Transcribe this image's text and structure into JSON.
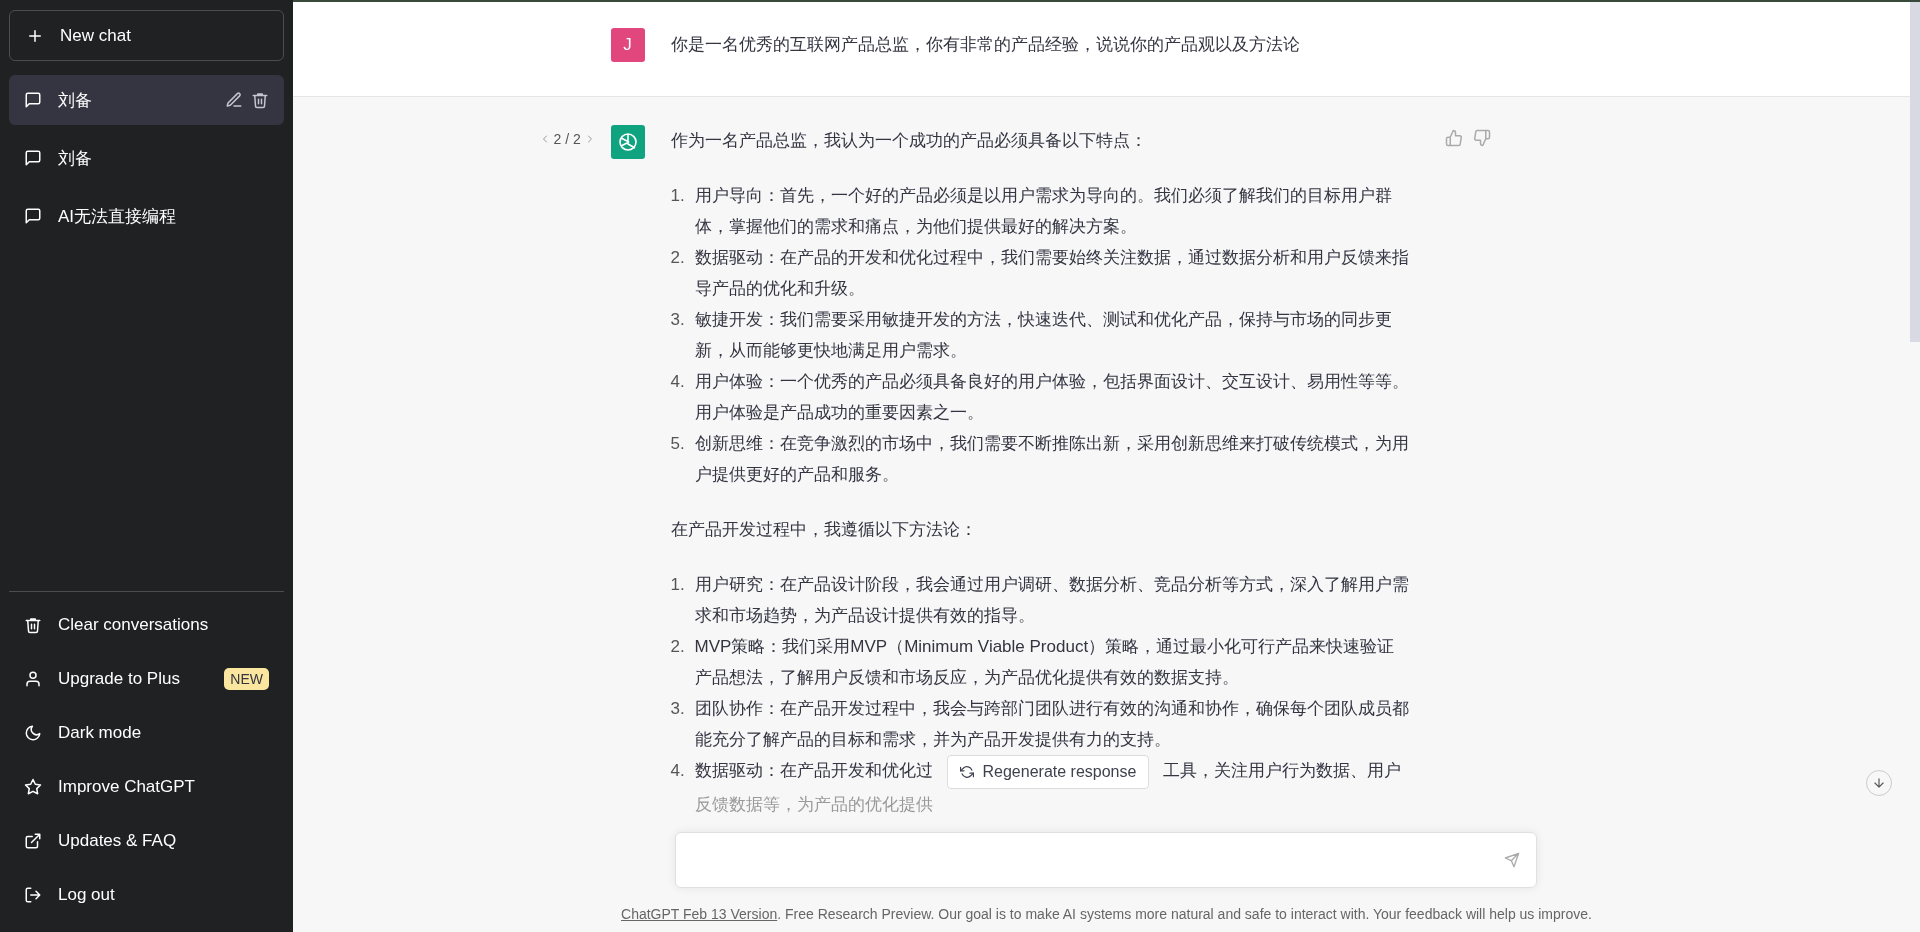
{
  "sidebar": {
    "new_chat": "New chat",
    "conversations": [
      {
        "title": "刘备",
        "selected": true
      },
      {
        "title": "刘备",
        "selected": false
      },
      {
        "title": "AI无法直接编程",
        "selected": false
      }
    ],
    "menu": [
      {
        "kind": "trash",
        "label": "Clear conversations"
      },
      {
        "kind": "user",
        "label": "Upgrade to Plus",
        "badge": "NEW"
      },
      {
        "kind": "moon",
        "label": "Dark mode"
      },
      {
        "kind": "star",
        "label": "Improve ChatGPT"
      },
      {
        "kind": "external",
        "label": "Updates & FAQ"
      },
      {
        "kind": "logout",
        "label": "Log out"
      }
    ]
  },
  "chat": {
    "user": {
      "avatar": "J",
      "text": "你是一名优秀的互联网产品总监，你有非常的产品经验，说说你的产品观以及方法论"
    },
    "assistant": {
      "pager": "2 / 2",
      "blocks": [
        {
          "kind": "paragraph",
          "text": "作为一名产品总监，我认为一个成功的产品必须具备以下特点："
        },
        {
          "kind": "list",
          "items": [
            {
              "kind": "text",
              "number": "1.",
              "text": "用户导向：首先，一个好的产品必须是以用户需求为导向的。我们必须了解我们的目标用户群体，掌握他们的需求和痛点，为他们提供最好的解决方案。"
            },
            {
              "kind": "text",
              "number": "2.",
              "text": "数据驱动：在产品的开发和优化过程中，我们需要始终关注数据，通过数据分析和用户反馈来指导产品的优化和升级。"
            },
            {
              "kind": "text",
              "number": "3.",
              "text": "敏捷开发：我们需要采用敏捷开发的方法，快速迭代、测试和优化产品，保持与市场的同步更新，从而能够更快地满足用户需求。"
            },
            {
              "kind": "text",
              "number": "4.",
              "text": "用户体验：一个优秀的产品必须具备良好的用户体验，包括界面设计、交互设计、易用性等等。用户体验是产品成功的重要因素之一。"
            },
            {
              "kind": "text",
              "number": "5.",
              "text": "创新思维：在竞争激烈的市场中，我们需要不断推陈出新，采用创新思维来打破传统模式，为用户提供更好的产品和服务。"
            }
          ]
        },
        {
          "kind": "paragraph",
          "text": "在产品开发过程中，我遵循以下方法论："
        },
        {
          "kind": "list",
          "items": [
            {
              "kind": "text",
              "number": "1.",
              "text": "用户研究：在产品设计阶段，我会通过用户调研、数据分析、竞品分析等方式，深入了解用户需求和市场趋势，为产品设计提供有效的指导。"
            },
            {
              "kind": "text",
              "number": "2.",
              "text": "MVP策略：我们采用MVP（Minimum Viable Product）策略，通过最小化可行产品来快速验证产品想法，了解用户反馈和市场反应，为产品优化提供有效的数据支持。"
            },
            {
              "kind": "text",
              "number": "3.",
              "text": "团队协作：在产品开发过程中，我会与跨部门团队进行有效的沟通和协作，确保每个团队成员都能充分了解产品的目标和需求，并为产品开发提供有力的支持。"
            },
            {
              "kind": "covered",
              "number": "4.",
              "before": "数据驱动：在产品开发和优化过",
              "after": "工具，关注用户行为数据、用户",
              "below": "反馈数据等，为产品的优化提供"
            }
          ]
        }
      ]
    },
    "regenerate": "Regenerate response"
  },
  "footer": {
    "link": "ChatGPT Feb 13 Version",
    "text": ". Free Research Preview. Our goal is to make AI systems more natural and safe to interact with. Your feedback will help us improve."
  }
}
